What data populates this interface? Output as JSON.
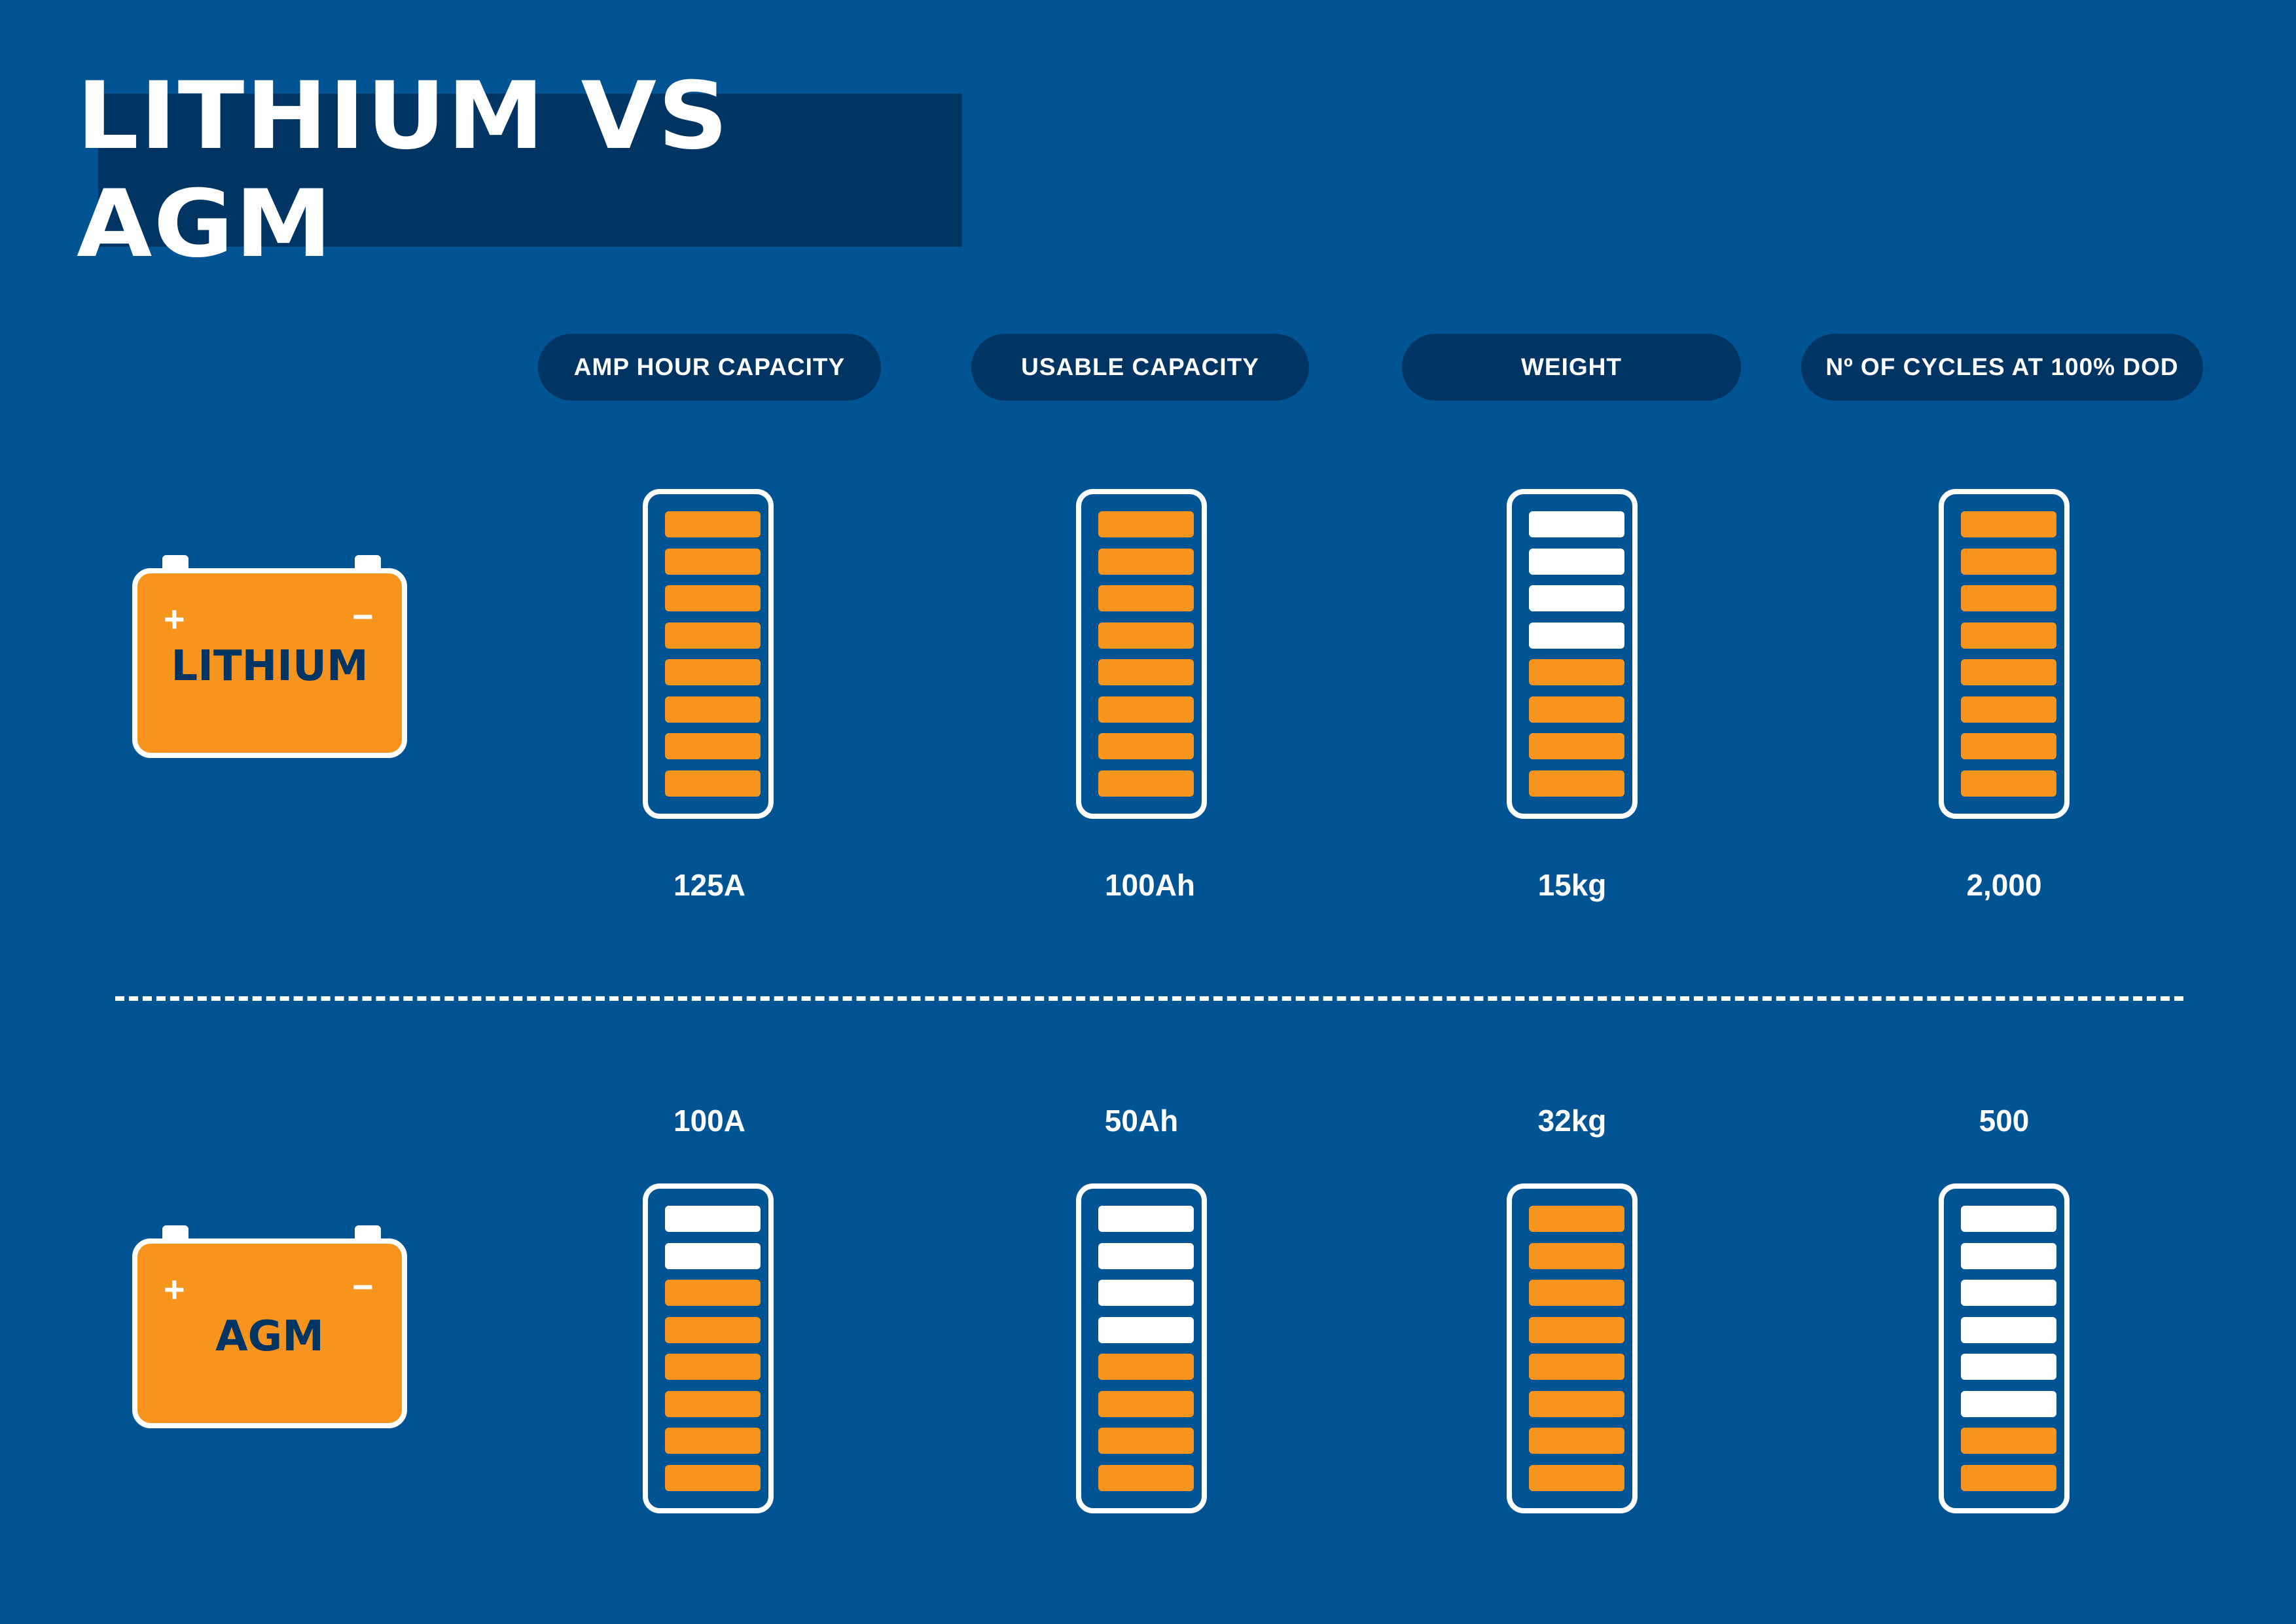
{
  "title": "LITHIUM VS AGM",
  "colors": {
    "background": "#005493",
    "dark_navy": "#003563",
    "orange": "#f7941d",
    "white": "#ffffff"
  },
  "chart_data": {
    "type": "table",
    "title": "LITHIUM VS AGM",
    "categories": [
      "AMP HOUR CAPACITY",
      "USABLE CAPACITY",
      "WEIGHT",
      "Nº OF CYCLES AT 100% DOD"
    ],
    "segments_per_gauge": 8,
    "series": [
      {
        "name": "LITHIUM",
        "values": [
          "125A",
          "100Ah",
          "15kg",
          "2,000"
        ],
        "gauge_filled": [
          8,
          8,
          4,
          8
        ]
      },
      {
        "name": "AGM",
        "values": [
          "100A",
          "50Ah",
          "32kg",
          "500"
        ],
        "gauge_filled": [
          6,
          4,
          8,
          2
        ]
      }
    ]
  },
  "battery_icons": {
    "plus": "+",
    "minus": "−"
  }
}
